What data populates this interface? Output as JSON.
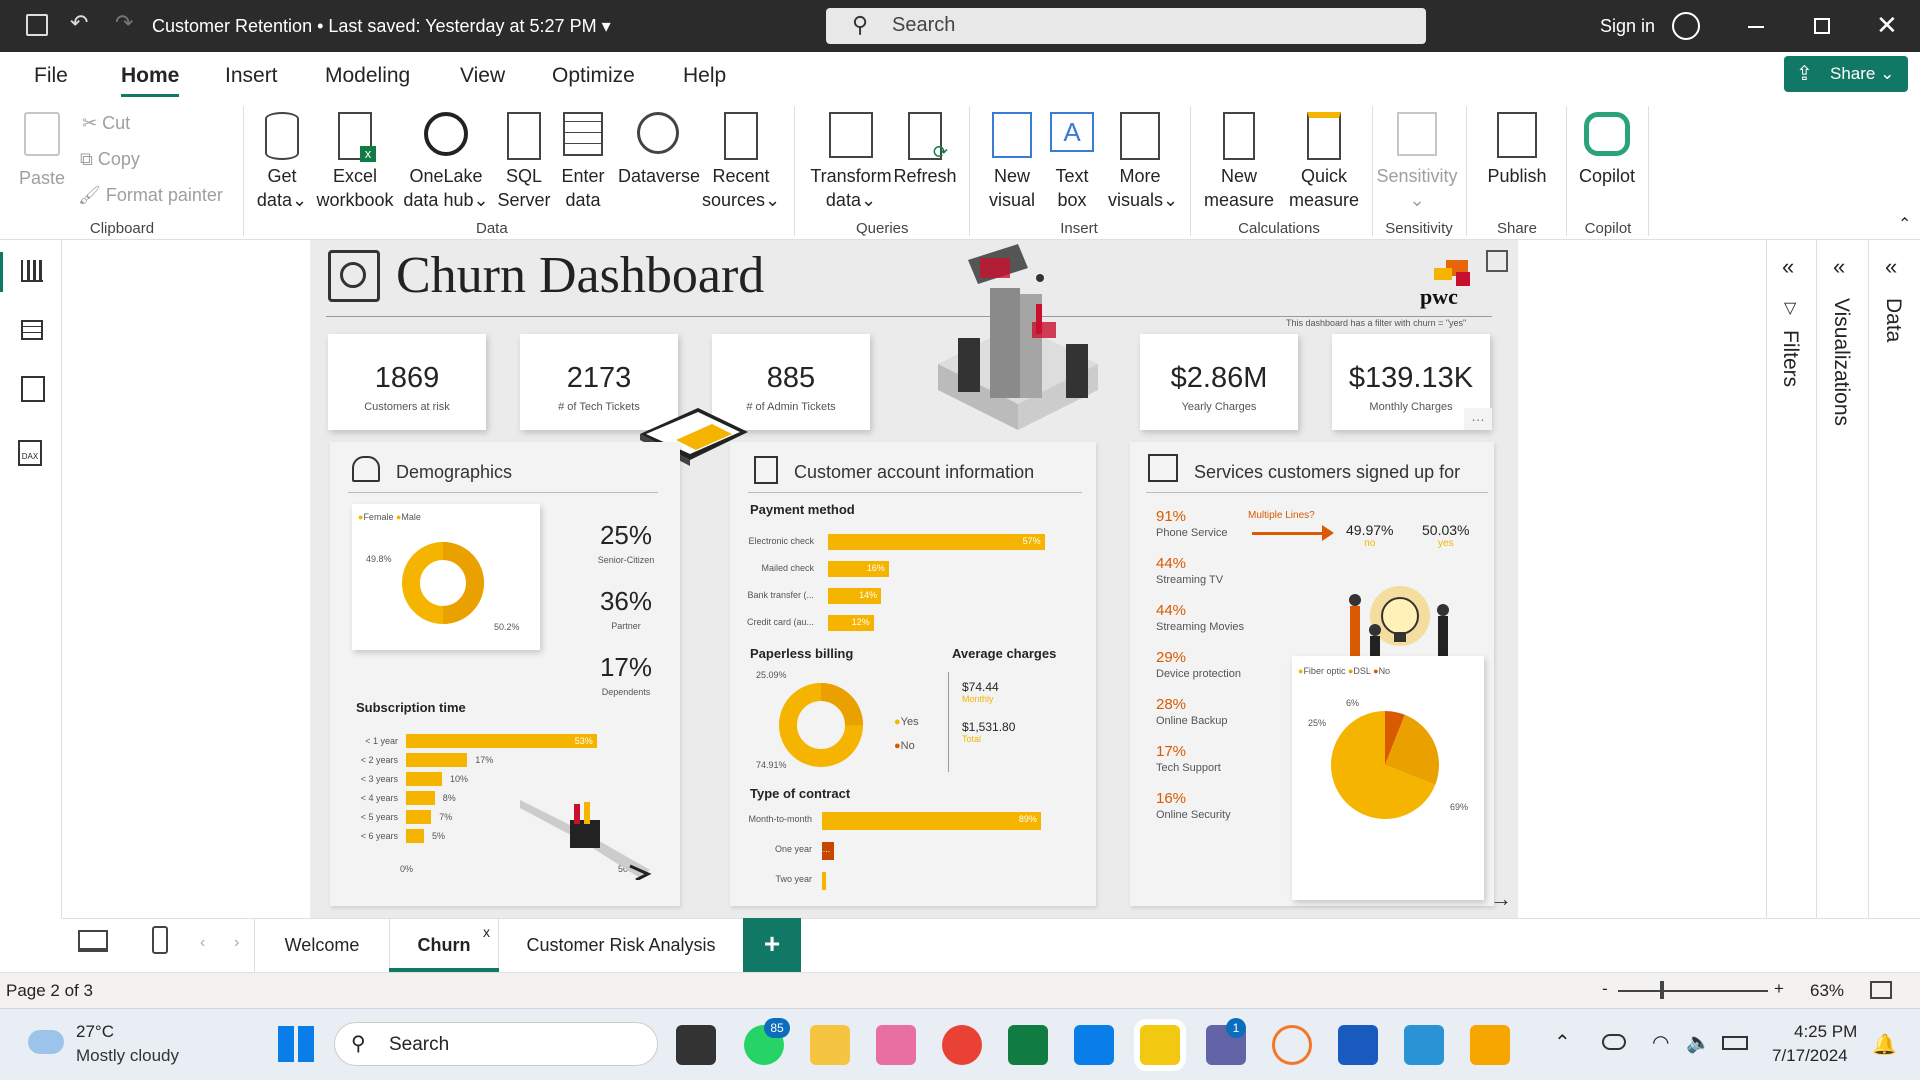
{
  "titlebar": {
    "doc_title": "Customer Retention",
    "saved": "• Last saved: Yesterday at 5:27 PM",
    "search_placeholder": "Search",
    "sign_in": "Sign in"
  },
  "menu": {
    "items": [
      "File",
      "Home",
      "Insert",
      "Modeling",
      "View",
      "Optimize",
      "Help"
    ],
    "share": "Share"
  },
  "ribbon": {
    "clipboard": {
      "paste": "Paste",
      "cut": "Cut",
      "copy": "Copy",
      "format_painter": "Format painter",
      "group": "Clipboard"
    },
    "data": {
      "get_data": [
        "Get",
        "data"
      ],
      "excel": [
        "Excel",
        "workbook"
      ],
      "onelake": [
        "OneLake",
        "data hub"
      ],
      "sql": [
        "SQL",
        "Server"
      ],
      "enter": [
        "Enter",
        "data"
      ],
      "dataverse": "Dataverse",
      "recent": [
        "Recent",
        "sources"
      ],
      "group": "Data"
    },
    "queries": {
      "transform": [
        "Transform",
        "data"
      ],
      "refresh": "Refresh",
      "group": "Queries"
    },
    "insert": {
      "new_visual": [
        "New",
        "visual"
      ],
      "text_box": [
        "Text",
        "box"
      ],
      "more_visuals": [
        "More",
        "visuals"
      ],
      "group": "Insert"
    },
    "calculations": {
      "new_measure": [
        "New",
        "measure"
      ],
      "quick_measure": [
        "Quick",
        "measure"
      ],
      "group": "Calculations"
    },
    "sensitivity": {
      "label": "Sensitivity",
      "group": "Sensitivity"
    },
    "share": {
      "publish": "Publish",
      "group": "Share"
    },
    "copilot": {
      "label": "Copilot",
      "group": "Copilot"
    }
  },
  "report": {
    "title": "Churn Dashboard",
    "logo": "pwc",
    "filter_note": "This dashboard has a filter with churn = \"yes\"",
    "kpis": [
      {
        "value": "1869",
        "label": "Customers at risk"
      },
      {
        "value": "2173",
        "label": "# of Tech Tickets"
      },
      {
        "value": "885",
        "label": "# of Admin Tickets"
      },
      {
        "value": "$2.86M",
        "label": "Yearly Charges"
      },
      {
        "value": "$139.13K",
        "label": "Monthly Charges"
      }
    ],
    "demographics": {
      "title": "Demographics",
      "legend": [
        "Female",
        "Male"
      ],
      "donut": {
        "female": 49.8,
        "male": 50.2,
        "label_female": "49.8%",
        "label_male": "50.2%"
      },
      "stats": [
        {
          "value": "25%",
          "label": "Senior-Citizen"
        },
        {
          "value": "36%",
          "label": "Partner"
        },
        {
          "value": "17%",
          "label": "Dependents"
        }
      ],
      "subscription_title": "Subscription time",
      "subscription": [
        {
          "label": "< 1 year",
          "value": 53,
          "text": "53%"
        },
        {
          "label": "< 2 years",
          "value": 17,
          "text": "17%"
        },
        {
          "label": "< 3 years",
          "value": 10,
          "text": "10%"
        },
        {
          "label": "< 4 years",
          "value": 8,
          "text": "8%"
        },
        {
          "label": "< 5 years",
          "value": 7,
          "text": "7%"
        },
        {
          "label": "< 6 years",
          "value": 5,
          "text": "5%"
        }
      ],
      "axis": [
        "0%",
        "50%"
      ]
    },
    "account": {
      "title": "Customer account information",
      "payment_title": "Payment method",
      "payment": [
        {
          "label": "Electronic check",
          "value": 57,
          "text": "57%"
        },
        {
          "label": "Mailed check",
          "value": 16,
          "text": "16%"
        },
        {
          "label": "Bank transfer (...",
          "value": 14,
          "text": "14%"
        },
        {
          "label": "Credit card (au...",
          "value": 12,
          "text": "12%"
        }
      ],
      "paperless_title": "Paperless billing",
      "paperless": {
        "yes": 74.91,
        "no": 25.09,
        "label_no": "25.09%",
        "label_yes": "74.91%",
        "legend": [
          "Yes",
          "No"
        ]
      },
      "avg_title": "Average charges",
      "avg": [
        {
          "value": "$74.44",
          "label": "Monthly"
        },
        {
          "value": "$1,531.80",
          "label": "Total"
        }
      ],
      "contract_title": "Type of contract",
      "contract": [
        {
          "label": "Month-to-month",
          "value": 89,
          "text": "89%"
        },
        {
          "label": "One year",
          "value": 5,
          "text": "..."
        },
        {
          "label": "Two year",
          "value": 1,
          "text": ""
        }
      ]
    },
    "services": {
      "title": "Services customers signed up for",
      "items": [
        {
          "pct": "91%",
          "label": "Phone Service"
        },
        {
          "pct": "44%",
          "label": "Streaming TV"
        },
        {
          "pct": "44%",
          "label": "Streaming Movies"
        },
        {
          "pct": "29%",
          "label": "Device protection"
        },
        {
          "pct": "28%",
          "label": "Online Backup"
        },
        {
          "pct": "17%",
          "label": "Tech Support"
        },
        {
          "pct": "16%",
          "label": "Online Security"
        }
      ],
      "multiple_lines": "Multiple Lines?",
      "ml_no": {
        "value": "49.97%",
        "label": "no"
      },
      "ml_yes": {
        "value": "50.03%",
        "label": "yes"
      },
      "internet_legend": [
        "Fiber optic",
        "DSL",
        "No"
      ],
      "pie": {
        "fiber": 69,
        "dsl": 25,
        "no": 6,
        "label_fiber": "69%",
        "label_dsl": "25%",
        "label_no": "6%"
      }
    }
  },
  "panes": {
    "filters": "Filters",
    "visualizations": "Visualizations",
    "data": "Data"
  },
  "tabs": {
    "pages": [
      "Welcome",
      "Churn",
      "Customer Risk Analysis"
    ],
    "active": "Churn",
    "close": "x",
    "add": "+"
  },
  "status": {
    "page": "Page 2 of 3",
    "zoom": "63%",
    "minus": "-",
    "plus": "+"
  },
  "taskbar": {
    "temp": "27°C",
    "weather": "Mostly cloudy",
    "search": "Search",
    "time": "4:25 PM",
    "date": "7/17/2024",
    "whatsapp_badge": "85",
    "teams_badge": "1"
  },
  "colors": {
    "accent": "#f5b400",
    "orange": "#d95a00",
    "dark_orange": "#c74600",
    "share_green": "#117865",
    "tab_teal": "#117865"
  }
}
